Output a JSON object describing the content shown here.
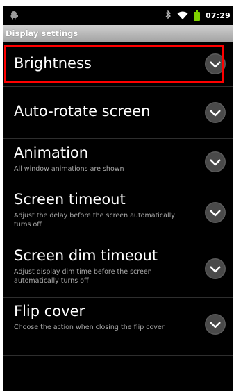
{
  "status_bar": {
    "time": "07:29",
    "icons": [
      "android-icon",
      "bluetooth-icon",
      "wifi-icon",
      "battery-icon"
    ],
    "battery_color": "#7fd000"
  },
  "title_bar": {
    "title": "Display settings"
  },
  "settings": [
    {
      "title": "Brightness",
      "summary": "",
      "highlighted": true
    },
    {
      "title": "Auto-rotate screen",
      "summary": ""
    },
    {
      "title": "Animation",
      "summary": "All window animations are shown"
    },
    {
      "title": "Screen timeout",
      "summary": "Adjust the delay before the screen automatically turns off"
    },
    {
      "title": "Screen dim timeout",
      "summary": "Adjust display dim time before the screen automatically turns off"
    },
    {
      "title": "Flip cover",
      "summary": "Choose the action when closing the flip cover"
    }
  ],
  "highlight_color": "#ff0000"
}
